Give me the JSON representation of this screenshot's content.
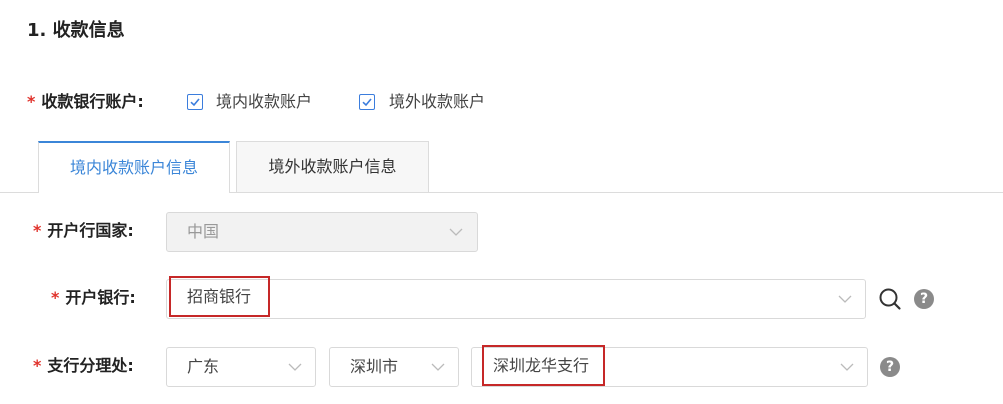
{
  "section": {
    "title": "1. 收款信息"
  },
  "receive_accounts": {
    "required_mark": "*",
    "label": "收款银行账户:",
    "options": [
      {
        "label": "境内收款账户",
        "checked": true
      },
      {
        "label": "境外收款账户",
        "checked": true
      }
    ]
  },
  "tabs": [
    {
      "label": "境内收款账户信息",
      "active": true
    },
    {
      "label": "境外收款账户信息",
      "active": false
    }
  ],
  "form": {
    "country": {
      "required_mark": "*",
      "label": "开户行国家:",
      "value": "中国",
      "disabled": true
    },
    "bank": {
      "required_mark": "*",
      "label": "开户银行:",
      "value": "招商银行"
    },
    "branch": {
      "required_mark": "*",
      "label": "支行分理处:",
      "province": "广东",
      "city": "深圳市",
      "value": "深圳龙华支行"
    }
  },
  "help_icon_glyph": "?",
  "colors": {
    "accent": "#3b86d8",
    "required": "#e0322b",
    "highlight": "#c62828"
  },
  "icons": {
    "search": "search-icon",
    "help": "help-icon",
    "chevron": "chevron-down-icon",
    "check": "check-icon"
  }
}
